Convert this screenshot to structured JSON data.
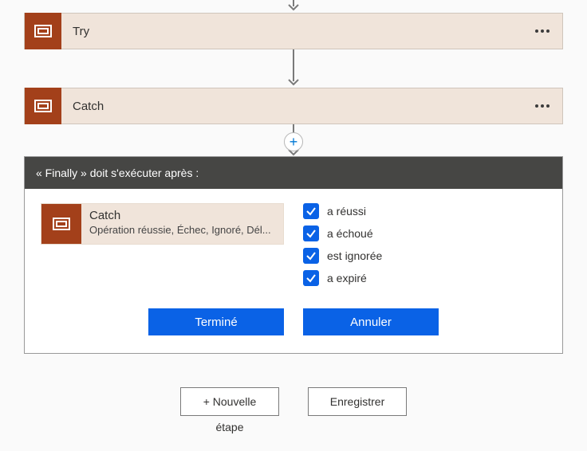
{
  "steps": {
    "try": {
      "label": "Try"
    },
    "catch": {
      "label": "Catch"
    }
  },
  "panel": {
    "header": "« Finally » doit s'exécuter après :",
    "card": {
      "title": "Catch",
      "subtitle": "Opération réussie, Échec, Ignoré, Dél..."
    },
    "checks": {
      "success": "a réussi",
      "failed": "a échoué",
      "skipped": "est ignorée",
      "timedout": "a expiré"
    },
    "buttons": {
      "done": "Terminé",
      "cancel": "Annuler"
    }
  },
  "footer": {
    "newstep_line1": "+ Nouvelle",
    "newstep_line2": "étape",
    "save": "Enregistrer"
  },
  "icons": {
    "plus": "+"
  }
}
